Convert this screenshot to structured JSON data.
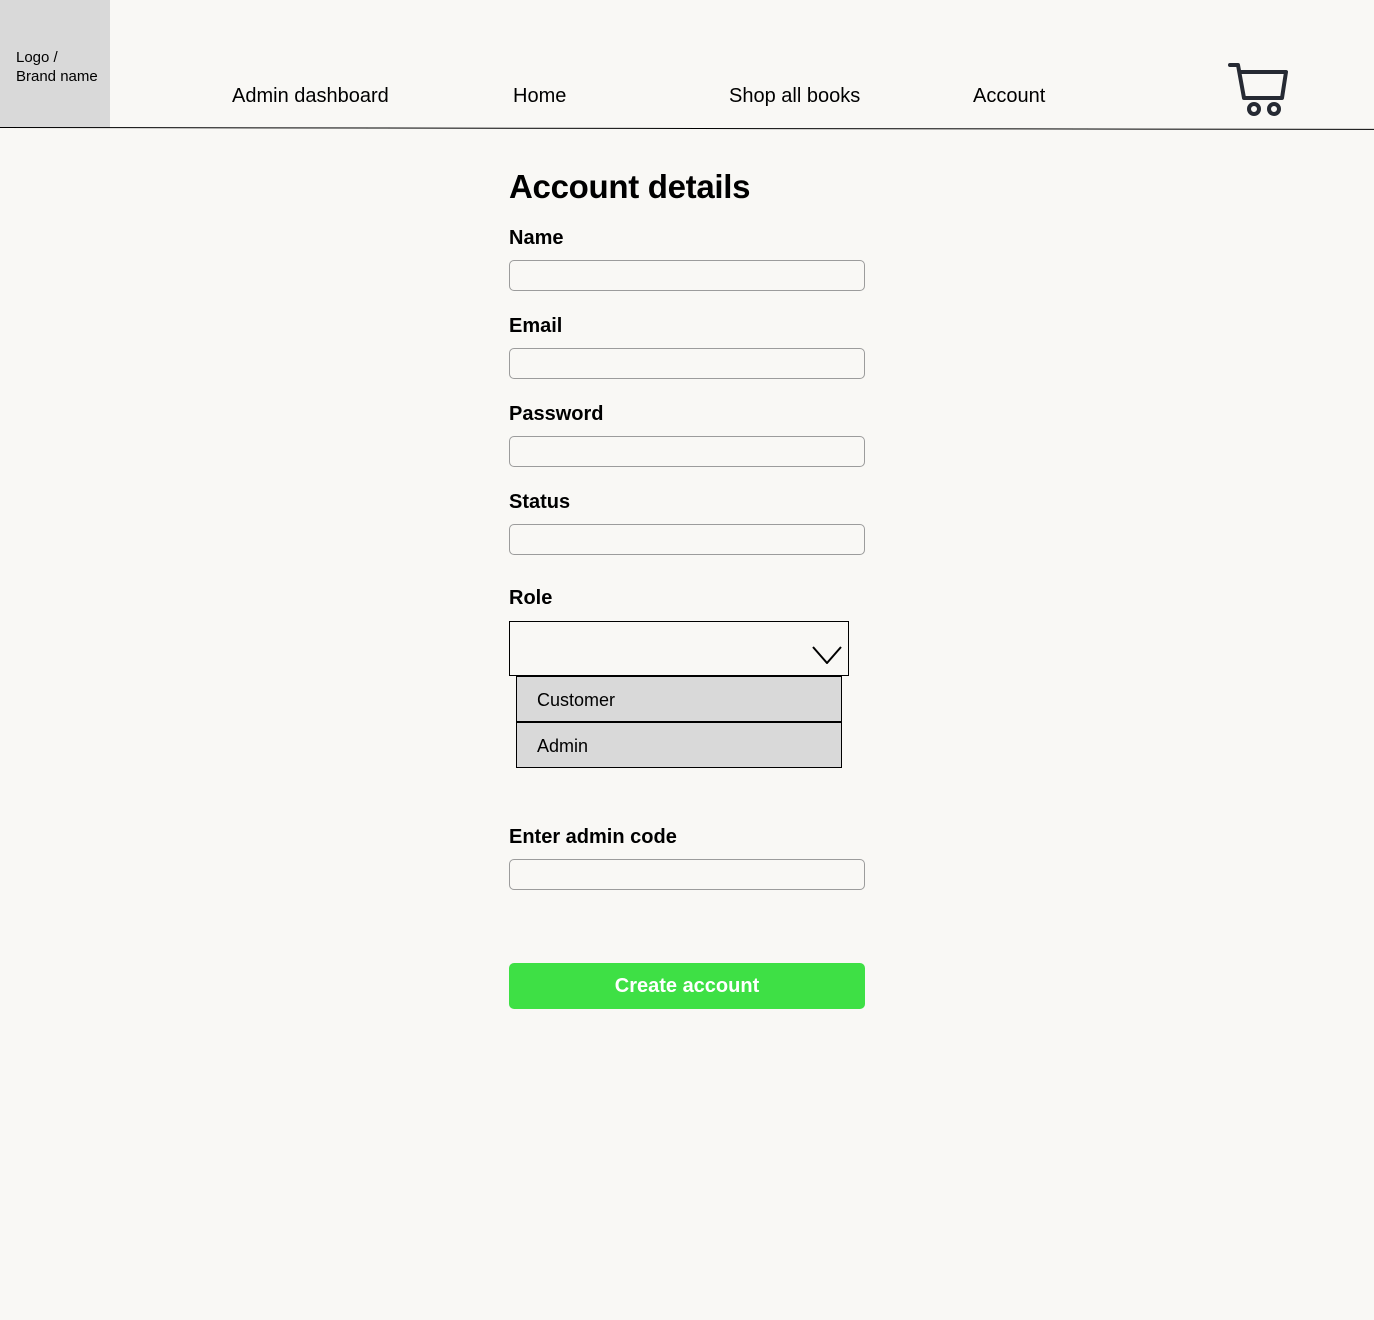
{
  "header": {
    "logo": "Logo /\nBrand name",
    "nav": [
      "Admin dashboard",
      "Home",
      "Shop all books",
      "Account"
    ],
    "cart_icon": "shopping-cart-icon"
  },
  "form": {
    "title": "Account details",
    "name_label": "Name",
    "email_label": "Email",
    "password_label": "Password",
    "status_label": "Status",
    "role_label": "Role",
    "role_options": [
      "Customer",
      "Admin"
    ],
    "admin_code_label": "Enter admin code",
    "submit_label": "Create account"
  },
  "colors": {
    "background": "#f9f8f5",
    "logo_bg": "#d9d9d9",
    "button": "#3ee045"
  }
}
